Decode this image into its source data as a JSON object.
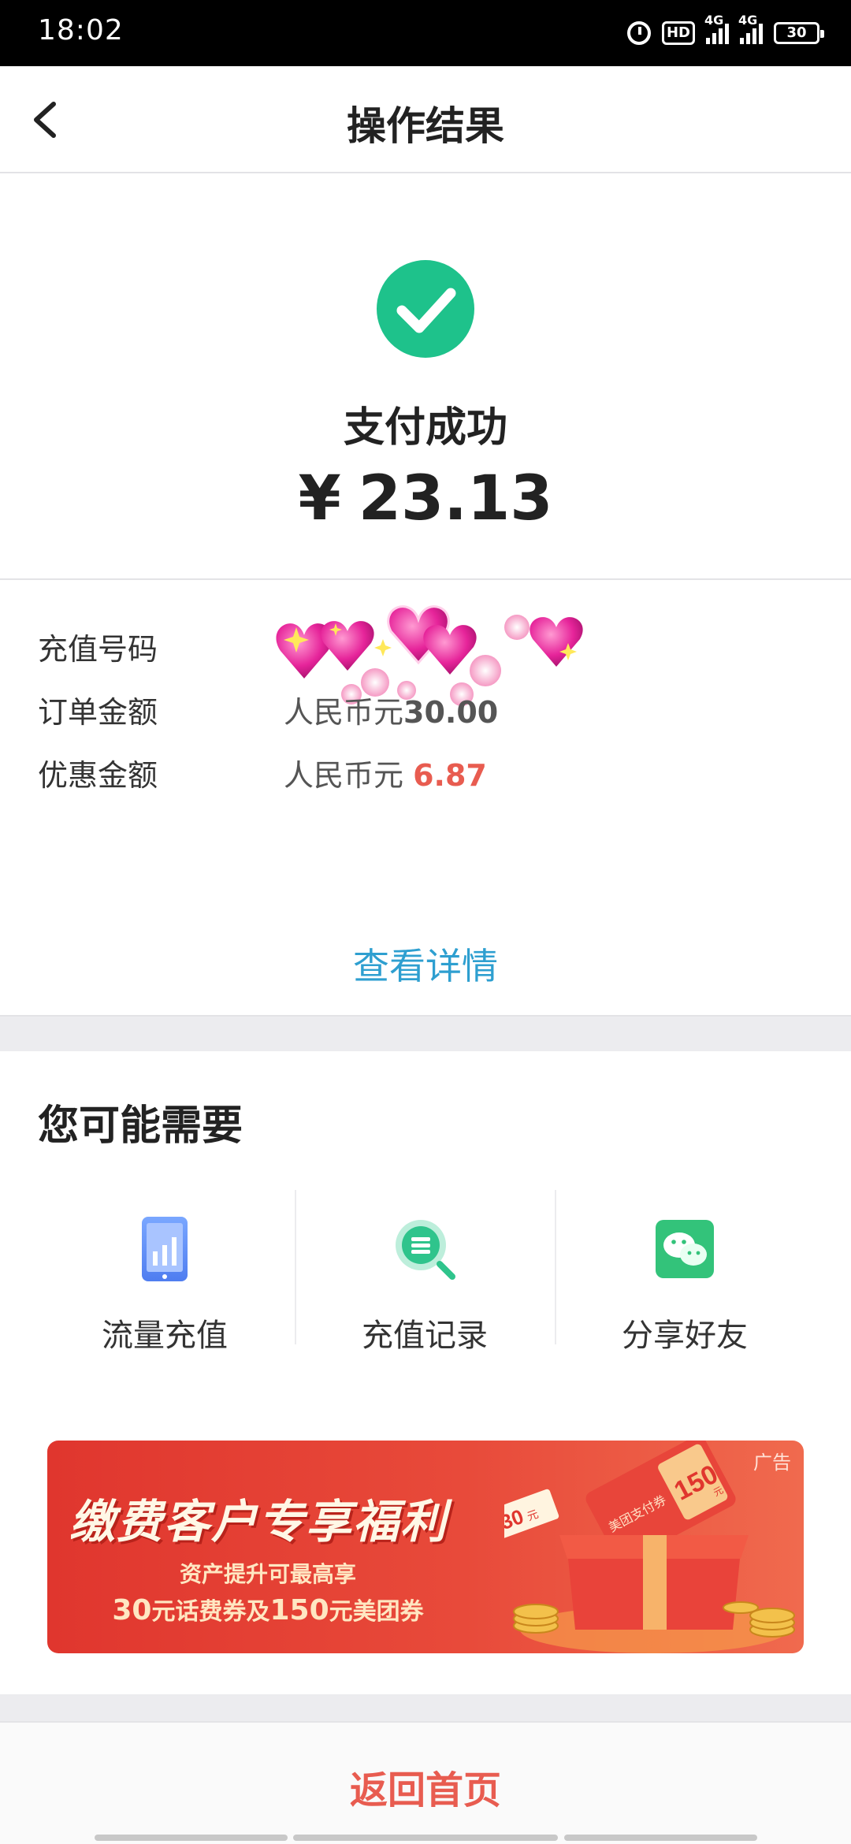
{
  "status_bar": {
    "time": "18:02",
    "hd_label": "HD",
    "signal_label": "4G",
    "battery": "30",
    "icons": [
      "alarm-icon",
      "hd-icon",
      "signal-4g-icon",
      "signal-4g-icon",
      "battery-icon"
    ]
  },
  "header": {
    "title": "操作结果",
    "back_icon": "chevron-left-icon"
  },
  "result": {
    "status_text": "支付成功",
    "currency_symbol": "¥",
    "amount": "23.13",
    "icon": "check-circle-icon",
    "accent_color": "#1ec28b"
  },
  "details": {
    "rows": [
      {
        "label": "充值号码",
        "value": ""
      },
      {
        "label": "订单金额",
        "value_prefix": "人民币元",
        "value_number": "30.00"
      },
      {
        "label": "优惠金额",
        "value_prefix": "人民币元 ",
        "value_number": "6.87"
      }
    ],
    "number_obscured_by": "heart-sticker-image",
    "view_details_link": "查看详情",
    "link_color": "#2e9fd0",
    "discount_color": "#e85c50"
  },
  "recommend": {
    "title": "您可能需要",
    "shortcuts": [
      {
        "label": "流量充值",
        "icon": "data-usage-icon"
      },
      {
        "label": "充值记录",
        "icon": "record-search-icon"
      },
      {
        "label": "分享好友",
        "icon": "wechat-icon"
      }
    ]
  },
  "banner": {
    "ad_tag": "广告",
    "headline": "缴费客户专享福利",
    "subline1": "资产提升可最高享",
    "subline2_a": "30",
    "subline2_b": "元话费券及",
    "subline2_c": "150",
    "subline2_d": "元美团券",
    "coupon_small": "30",
    "coupon_small_unit": "元",
    "coupon_large": "150",
    "coupon_large_unit": "元",
    "coupon_caption": "美团支付券"
  },
  "bottom": {
    "home_button": "返回首页",
    "button_color": "#e85c50"
  }
}
